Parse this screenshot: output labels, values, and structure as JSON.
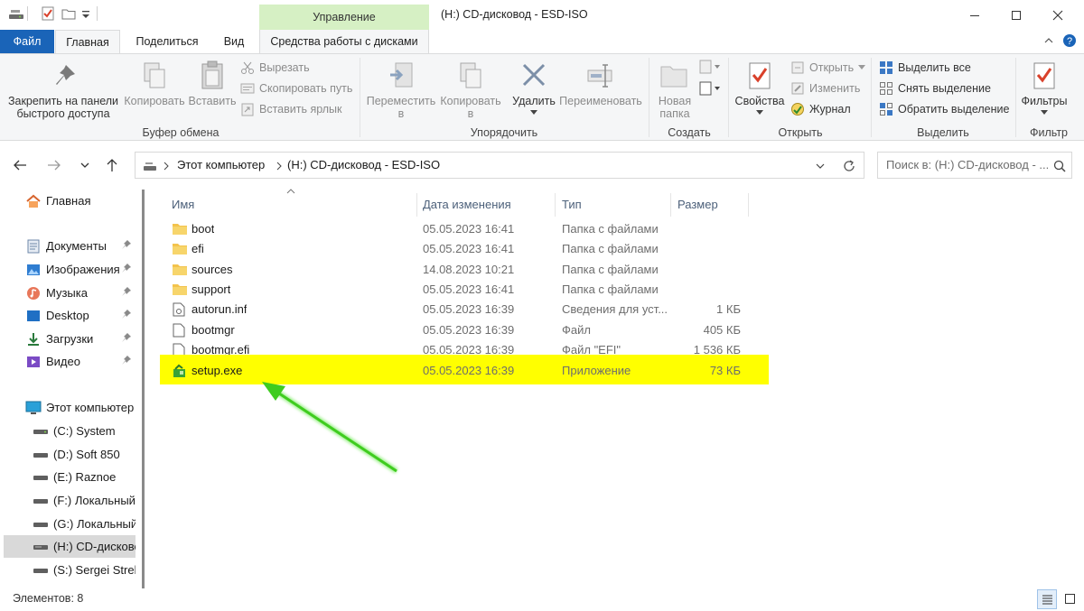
{
  "window": {
    "title": "(H:) CD-дисковод - ESD-ISO",
    "context_tab_header": "Управление"
  },
  "tabs": {
    "file": "Файл",
    "home": "Главная",
    "share": "Поделиться",
    "view": "Вид",
    "context": "Средства работы с дисками"
  },
  "ribbon": {
    "pin": "Закрепить на панели быстрого доступа",
    "pin_line1": "Закрепить на панели",
    "pin_line2": "быстрого доступа",
    "copy": "Копировать",
    "paste": "Вставить",
    "cut": "Вырезать",
    "copy_path": "Скопировать путь",
    "paste_shortcut": "Вставить ярлык",
    "group_clipboard": "Буфер обмена",
    "move_to_line1": "Переместить",
    "move_to_line2": "в",
    "copy_to_line1": "Копировать",
    "copy_to_line2": "в",
    "delete": "Удалить",
    "rename": "Переименовать",
    "group_organize": "Упорядочить",
    "new_folder_line1": "Новая",
    "new_folder_line2": "папка",
    "group_new": "Создать",
    "properties": "Свойства",
    "open": "Открыть",
    "edit": "Изменить",
    "history": "Журнал",
    "group_open": "Открыть",
    "select_all": "Выделить все",
    "select_none": "Снять выделение",
    "invert_selection": "Обратить выделение",
    "group_select": "Выделить",
    "filters": "Фильтры",
    "group_filter": "Фильтр"
  },
  "address": {
    "crumb1": "Этот компьютер",
    "crumb2": "(H:) CD-дисковод - ESD-ISO",
    "search_placeholder": "Поиск в: (H:) CD-дисковод - ..."
  },
  "nav": {
    "home": "Главная",
    "quick": [
      {
        "label": "Документы"
      },
      {
        "label": "Изображения"
      },
      {
        "label": "Музыка"
      },
      {
        "label": "Desktop"
      },
      {
        "label": "Загрузки"
      },
      {
        "label": "Видео"
      }
    ],
    "this_pc": "Этот компьютер",
    "drives": [
      {
        "label": "(C:) System"
      },
      {
        "label": "(D:) Soft 850"
      },
      {
        "label": "(E:) Raznoe"
      },
      {
        "label": "(F:) Локальный"
      },
      {
        "label": "(G:) Локальный"
      },
      {
        "label": "(H:) CD-дисковод"
      },
      {
        "label": "(S:) Sergei Strele"
      }
    ]
  },
  "columns": {
    "name": "Имя",
    "date": "Дата изменения",
    "type": "Тип",
    "size": "Размер"
  },
  "files": [
    {
      "name": "boot",
      "date": "05.05.2023 16:41",
      "type": "Папка с файлами",
      "size": "",
      "icon": "folder-icon"
    },
    {
      "name": "efi",
      "date": "05.05.2023 16:41",
      "type": "Папка с файлами",
      "size": "",
      "icon": "folder-icon"
    },
    {
      "name": "sources",
      "date": "14.08.2023 10:21",
      "type": "Папка с файлами",
      "size": "",
      "icon": "folder-icon"
    },
    {
      "name": "support",
      "date": "05.05.2023 16:41",
      "type": "Папка с файлами",
      "size": "",
      "icon": "folder-icon"
    },
    {
      "name": "autorun.inf",
      "date": "05.05.2023 16:39",
      "type": "Сведения для уст...",
      "size": "1 КБ",
      "icon": "settings-file-icon"
    },
    {
      "name": "bootmgr",
      "date": "05.05.2023 16:39",
      "type": "Файл",
      "size": "405 КБ",
      "icon": "file-icon"
    },
    {
      "name": "bootmgr.efi",
      "date": "05.05.2023 16:39",
      "type": "Файл \"EFI\"",
      "size": "1 536 КБ",
      "icon": "file-icon"
    },
    {
      "name": "setup.exe",
      "date": "05.05.2023 16:39",
      "type": "Приложение",
      "size": "73 КБ",
      "icon": "setup-icon"
    }
  ],
  "status": {
    "items": "Элементов: 8"
  },
  "colors": {
    "file_tab": "#1a64b8",
    "context_tab": "#d6f0c4",
    "highlight": "#ffff00",
    "arrow": "#3fcc1f",
    "folder": "#f3c34d"
  }
}
